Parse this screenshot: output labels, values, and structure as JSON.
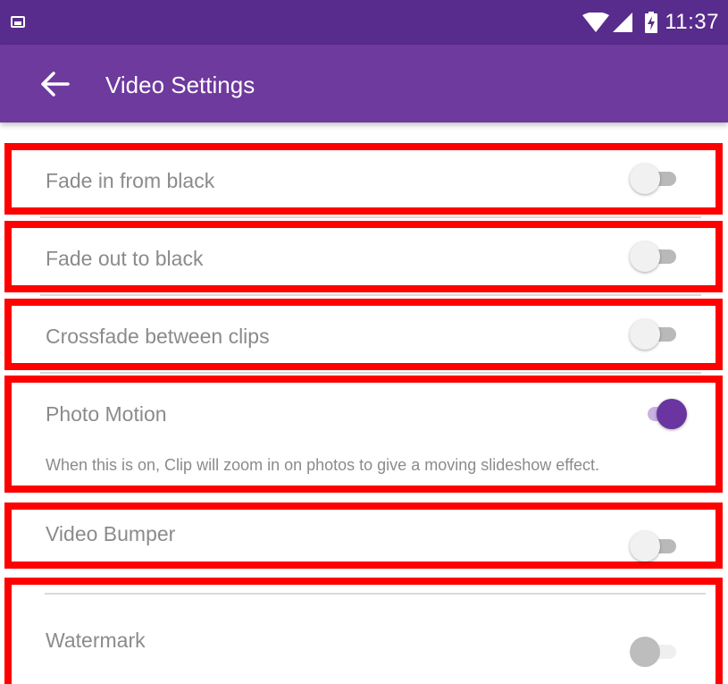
{
  "status_bar": {
    "time": "11:37",
    "icons": [
      "image-notification-icon",
      "wifi-icon",
      "cell-signal-icon",
      "battery-charging-icon"
    ]
  },
  "app_bar": {
    "title": "Video Settings",
    "back_icon": "back-arrow-icon"
  },
  "settings": [
    {
      "label": "Fade in from black",
      "enabled": false
    },
    {
      "label": "Fade out to black",
      "enabled": false
    },
    {
      "label": "Crossfade between clips",
      "enabled": false
    },
    {
      "label": "Photo Motion",
      "enabled": true,
      "description": "When this is on, Clip will zoom in on photos to give a moving slideshow effect."
    },
    {
      "label": "Video Bumper",
      "enabled": false
    },
    {
      "label": "Watermark",
      "enabled": false,
      "disabled": true
    }
  ],
  "colors": {
    "status_bar": "#582c8c",
    "app_bar": "#6e3a9e",
    "accent": "#6a35a0",
    "highlight_border": "#ff0000"
  }
}
